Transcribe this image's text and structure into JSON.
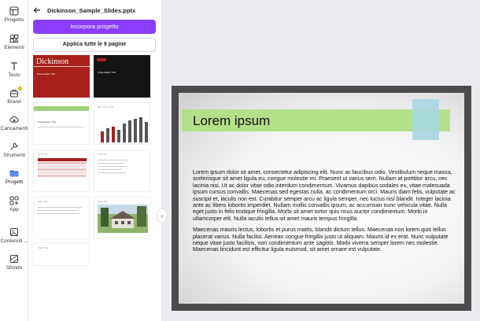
{
  "rail": {
    "items": [
      {
        "label": "Progetto",
        "icon": "grid-icon"
      },
      {
        "label": "Elementi",
        "icon": "shapes-icon"
      },
      {
        "label": "Testo",
        "icon": "text-icon"
      },
      {
        "label": "Brand",
        "icon": "brand-icon"
      },
      {
        "label": "Caricamenti",
        "icon": "cloud-upload-icon"
      },
      {
        "label": "Strumenti",
        "icon": "tools-icon"
      },
      {
        "label": "Progetti",
        "icon": "folder-icon"
      },
      {
        "label": "App",
        "icon": "apps-icon"
      },
      {
        "label": "Contenuti ...",
        "icon": "content-icon"
      },
      {
        "label": "Sfondo",
        "icon": "background-icon"
      }
    ]
  },
  "panel": {
    "file_name": "Dickinson_Sample_Slides.pptx",
    "import_button": "Incorpora progetto",
    "apply_button": "Applica tutte le 9 pagine",
    "thumbs": {
      "t1_title": "Dickinson",
      "t1_sub": "Presentation Title",
      "t2_sub": "Presentation Title",
      "t3_text": "Presentation Title",
      "t4_text": "Bar Graph Title",
      "t5_text": "Chart Title",
      "t6_text": "List Title",
      "t7_text": "Slide Title",
      "t8_text": "Slide Title",
      "t9_text": "Page Title"
    }
  },
  "slide": {
    "title": "Lorem ipsum",
    "paragraph1": "Lorem ipsum dolor sit amet, consectetur adipiscing elit. Nunc ac faucibus odio. Vestibulum neque massa, scelerisque sit amet ligula eu, congue molestie mi. Praesent ut varius sem. Nullam at porttitor arcu, nec lacinia nisi. Ut ac dolor vitae odio interdum condimentum. Vivamus dapibus sodales ex, vitae malesuada ipsum cursus convallis. Maecenas sed egestas nulla, ac condimentum orci. Mauris diam felis, vulputate ac suscipit et, iaculis non est. Curabitur semper arcu ac ligula semper, nec luctus nisl blandit. Integer lacinia ante ac libero lobortis imperdiet. Nullam mollis convallis ipsum, ac accumsan nunc vehicula vitae. Nulla eget justo in felis tristique fringilla. Morbi sit amet tortor quis risus auctor condimentum. Morbi in ullamcorper elit. Nulla iaculis tellus sit amet mauris tempus fringilla.",
    "paragraph2": "Maecenas mauris lectus, lobortis et purus mattis, blandit dictum tellus. Maecenas non lorem quis tellus placerat varius. Nulla facilisi. Aenean congue fringilla justo ut aliquam. Mauris id ex erat. Nunc vulputate neque vitae justo facilisis, non condimentum ante sagittis. Morbi viverra semper lorem nec molestie. Maecenas tincidunt est efficitur ligula euismod, sit amet ornare est vulputate."
  },
  "colors": {
    "accent": "#8b3dff",
    "title_band": "#b3e089",
    "title_stripe": "#a7d7e2",
    "slide_frame": "#4b4b4b"
  }
}
